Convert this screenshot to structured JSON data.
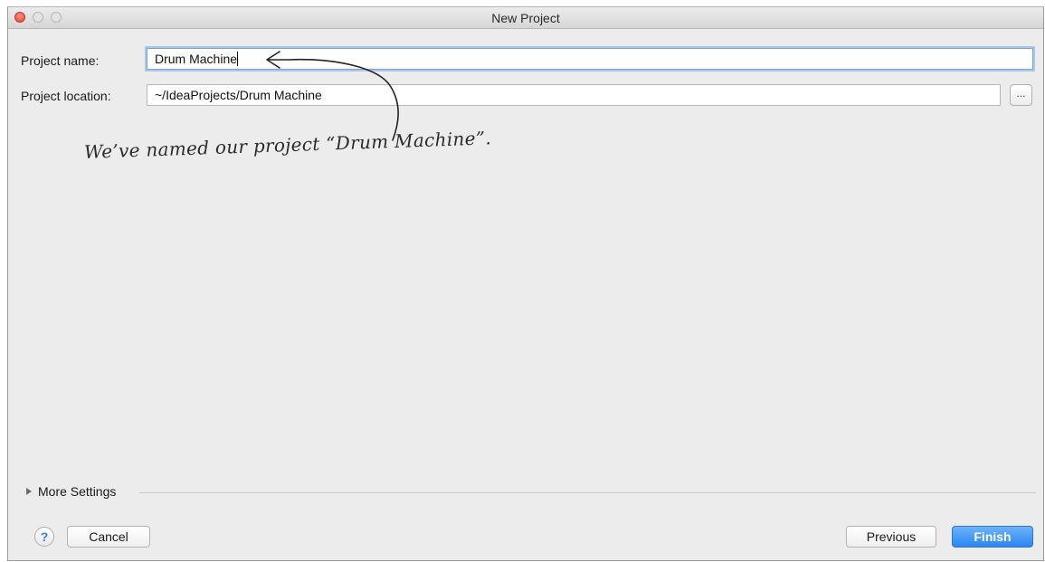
{
  "window": {
    "title": "New Project"
  },
  "form": {
    "project_name_label": "Project name:",
    "project_name_value": "Drum Machine",
    "project_location_label": "Project location:",
    "project_location_value": "~/IdeaProjects/Drum Machine",
    "browse_label": "..."
  },
  "annotation": {
    "text": "We’ve named our project “Drum Machine”."
  },
  "footer": {
    "more_settings_label": "More Settings",
    "help_label": "?",
    "cancel_label": "Cancel",
    "previous_label": "Previous",
    "finish_label": "Finish"
  },
  "colors": {
    "window_bg": "#ececec",
    "focus_ring": "#a9c7ec",
    "primary_button": "#2b86f0",
    "close_button": "#e0443a"
  }
}
